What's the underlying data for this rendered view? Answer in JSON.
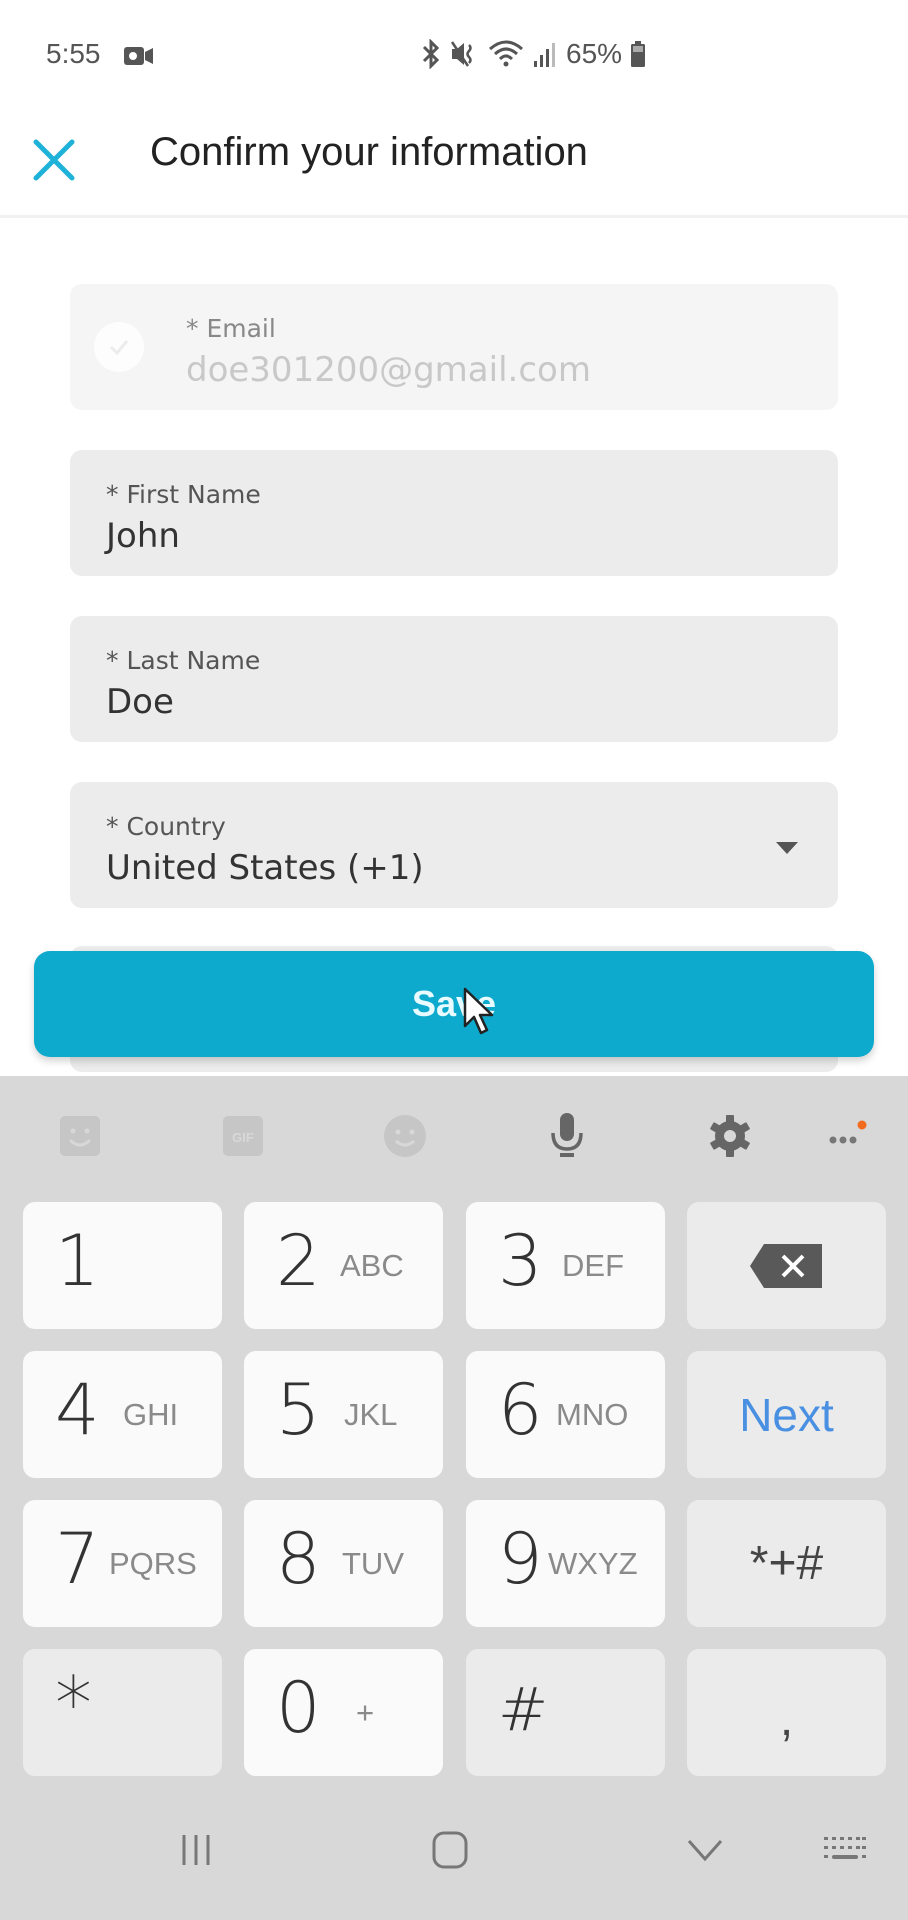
{
  "status_bar": {
    "time": "5:55",
    "battery": "65%",
    "icons": [
      "screen-record-icon",
      "bluetooth-icon",
      "mute-vibrate-icon",
      "wifi-icon",
      "signal-icon",
      "battery-icon"
    ]
  },
  "header": {
    "title": "Confirm your information",
    "close_icon": "close-icon"
  },
  "form": {
    "fields": [
      {
        "label": "* Email",
        "value": "doe301200@gmail.com",
        "disabled": true,
        "verified": true
      },
      {
        "label": "* First Name",
        "value": "John"
      },
      {
        "label": "* Last Name",
        "value": "Doe"
      },
      {
        "label": "* Country",
        "value": "United States (+1)",
        "type": "dropdown"
      }
    ],
    "save_label": "Save"
  },
  "keyboard": {
    "toolbar": [
      "sticker-icon",
      "gif-icon",
      "emoji-icon",
      "microphone-icon",
      "settings-icon",
      "more-icon"
    ],
    "toolbar_labels": {
      "gif": "GIF"
    },
    "keys": [
      {
        "digit": "1",
        "letters": ""
      },
      {
        "digit": "2",
        "letters": "ABC"
      },
      {
        "digit": "3",
        "letters": "DEF"
      },
      {
        "digit": "4",
        "letters": "GHI"
      },
      {
        "digit": "5",
        "letters": "JKL"
      },
      {
        "digit": "6",
        "letters": "MNO"
      },
      {
        "digit": "7",
        "letters": "PQRS"
      },
      {
        "digit": "8",
        "letters": "TUV"
      },
      {
        "digit": "9",
        "letters": "WXYZ"
      },
      {
        "digit": "0",
        "letters": "+"
      }
    ],
    "func_keys": {
      "next": "Next",
      "symbols": "*+#",
      "star": "*",
      "hash": "#",
      "comma": ","
    }
  },
  "nav_bar": [
    "recent-apps-icon",
    "home-icon",
    "back-icon",
    "keyboard-switch-icon"
  ],
  "colors": {
    "accent": "#0eaacd",
    "next": "#4a90e2",
    "notification_dot": "#f26b1d"
  }
}
